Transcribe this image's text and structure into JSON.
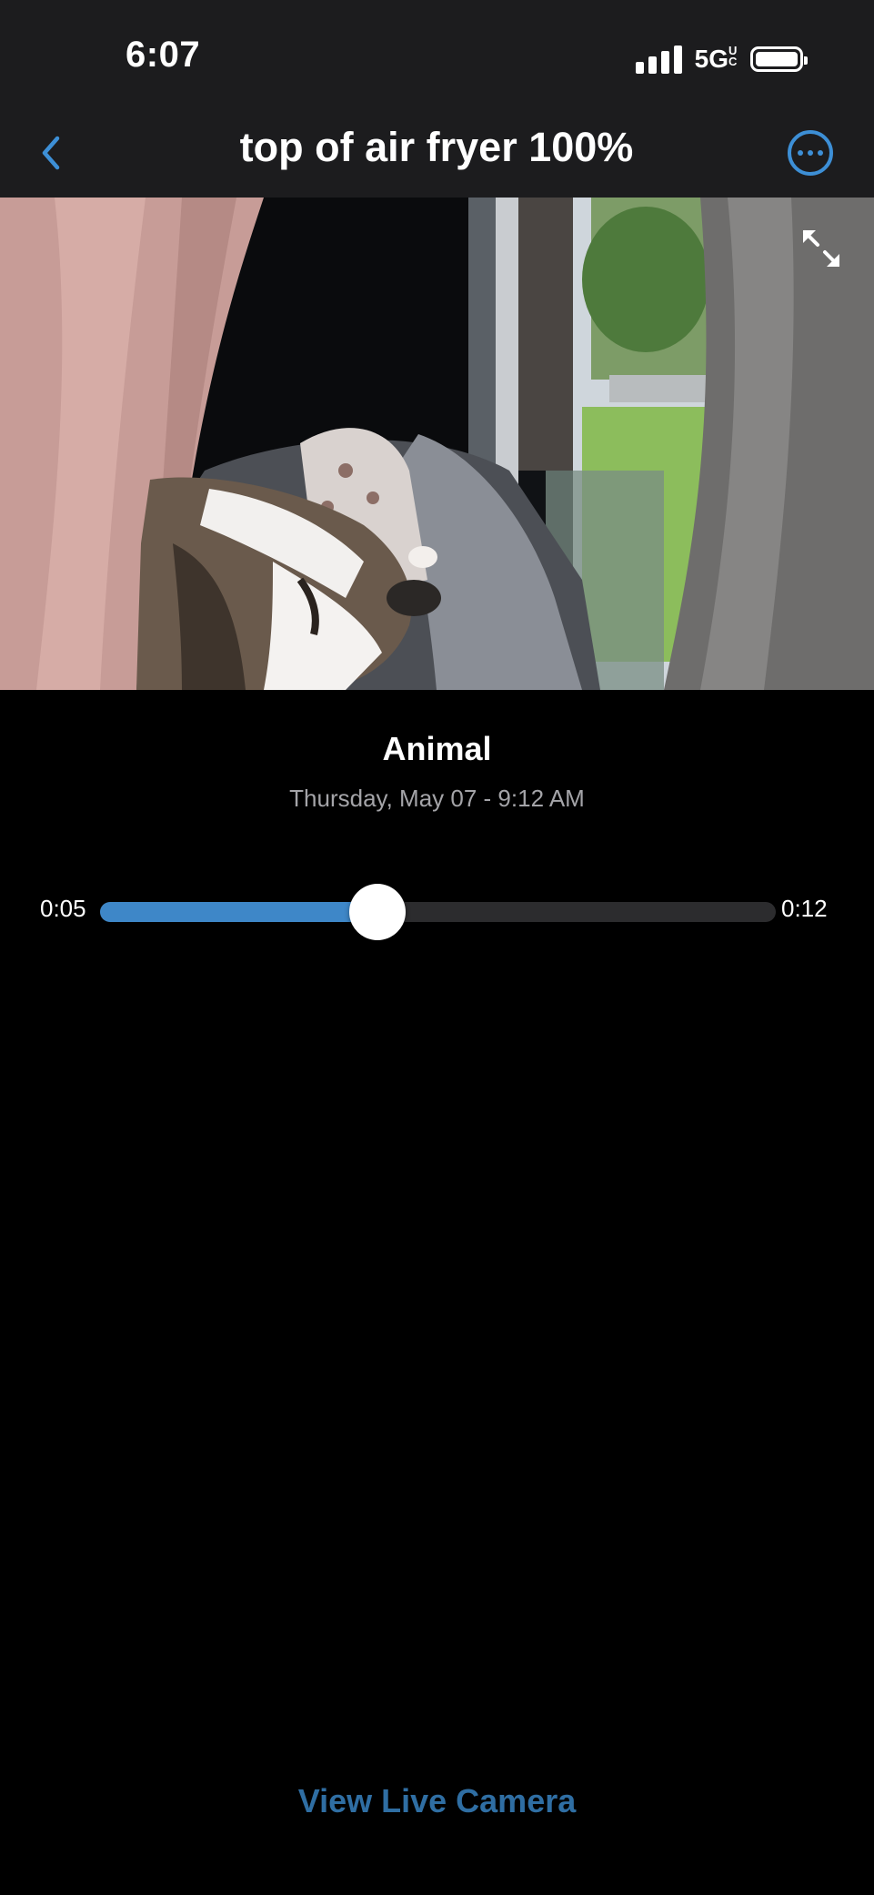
{
  "status_bar": {
    "time": "6:07",
    "network": "5G",
    "network_sub": "UC",
    "signal_bars": 4,
    "battery_level": 1.0
  },
  "nav": {
    "back_icon": "chevron-left-icon",
    "title": "top of air fryer 100%",
    "more_icon": "ellipsis-circle-icon"
  },
  "video": {
    "expand_icon": "expand-arrows-icon"
  },
  "event": {
    "title": "Animal",
    "timestamp": "Thursday, May 07 - 9:12 AM"
  },
  "scrubber": {
    "current": "0:05",
    "duration": "0:12",
    "progress": 0.41
  },
  "footer": {
    "live_link": "View Live Camera"
  },
  "colors": {
    "accent": "#3d8fd6",
    "progress": "#3e87c8",
    "link": "#2f6ea3",
    "bar_background": "#1c1c1e"
  }
}
